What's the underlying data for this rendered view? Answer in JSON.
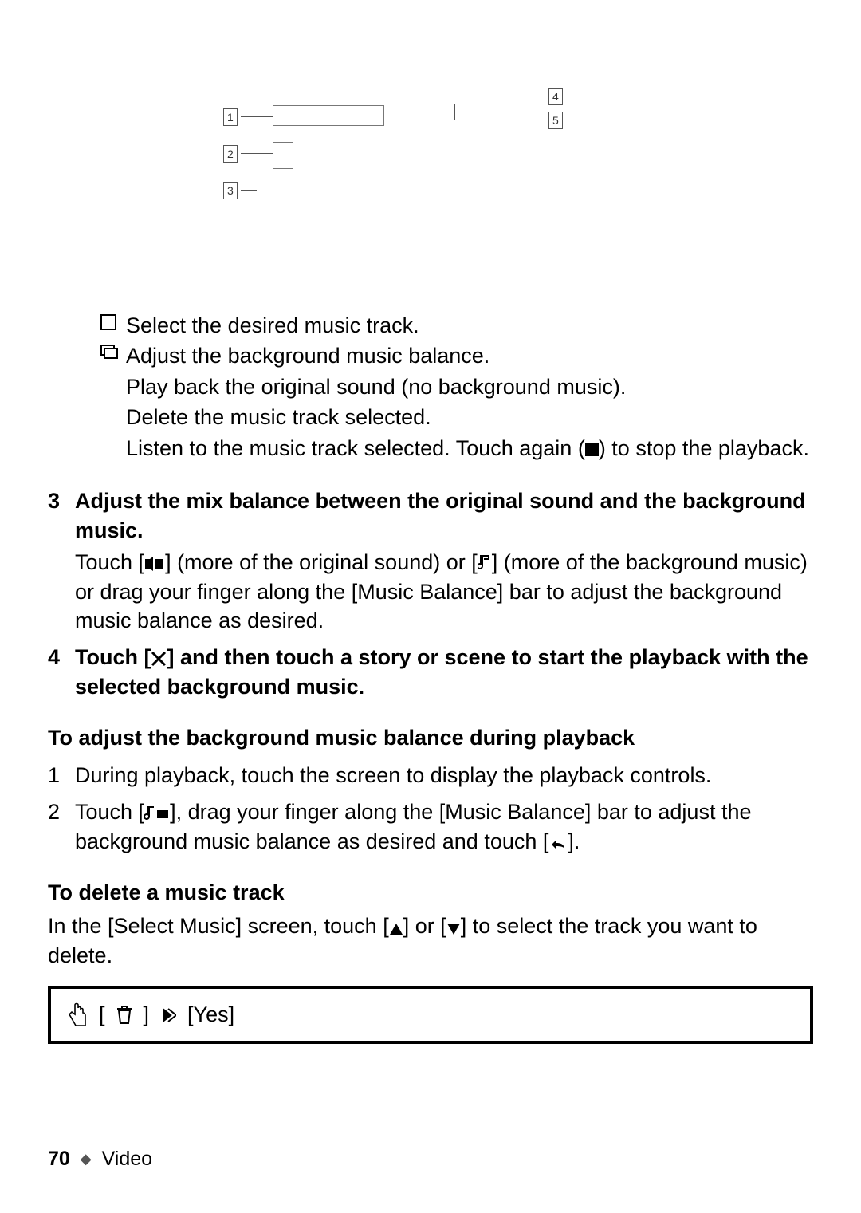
{
  "diagram": {
    "labels": [
      "1",
      "2",
      "3",
      "4",
      "5"
    ]
  },
  "legend": {
    "l1": "Select the desired music track.",
    "l2": "Adjust the background music balance.",
    "l3": "Play back the original sound (no background music).",
    "l4": "Delete the music track selected.",
    "l5a": "Listen to the music track selected. Touch again (",
    "l5b": ") to stop the playback."
  },
  "step3": {
    "num": "3",
    "head": "Adjust the mix balance between the original sound and the background music.",
    "t1": "Touch [",
    "t2": "] (more of the original sound) or [",
    "t3": "] (more of the background music) or drag your finger along the [Music Balance] bar to adjust the background music balance as desired."
  },
  "step4": {
    "num": "4",
    "head1": "Touch [",
    "head2": "] and then touch a story or scene to start the playback with the selected background music."
  },
  "adj": {
    "head": "To adjust the background music balance during playback",
    "s1num": "1",
    "s1": "During playback, touch the screen to display the playback controls.",
    "s2num": "2",
    "s2a": "Touch [",
    "s2b": "], drag your finger along the [Music Balance] bar to adjust the background music balance as desired and touch [",
    "s2c": "]."
  },
  "del": {
    "head": "To delete a music track",
    "t1": "In the [Select Music] screen, touch [",
    "t2": "] or [",
    "t3": "] to select the track you want to delete."
  },
  "bar": {
    "trash": "[",
    "trash2": "]",
    "yes": "[Yes]"
  },
  "footer": {
    "page": "70",
    "section": "Video"
  }
}
